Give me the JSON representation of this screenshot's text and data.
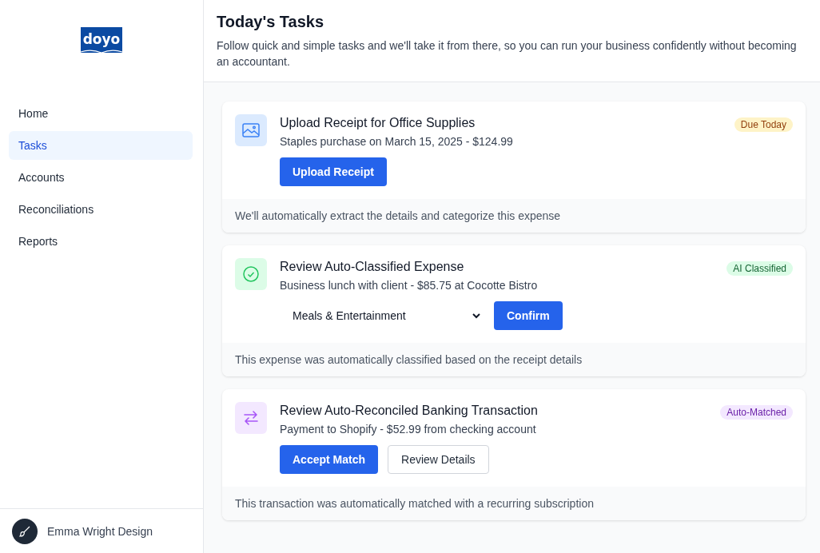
{
  "logo": {
    "text": "doyo"
  },
  "sidebar": {
    "items": [
      {
        "label": "Home",
        "selected": false
      },
      {
        "label": "Tasks",
        "selected": true
      },
      {
        "label": "Accounts",
        "selected": false
      },
      {
        "label": "Reconciliations",
        "selected": false
      },
      {
        "label": "Reports",
        "selected": false
      }
    ],
    "user": {
      "name": "Emma Wright Design"
    }
  },
  "header": {
    "title": "Today's Tasks",
    "subtitle": "Follow quick and simple tasks and we'll take it from there, so you can run your business confidently without becoming an accountant."
  },
  "tasks": [
    {
      "kind": "upload",
      "title": "Upload Receipt for Office Supplies",
      "detail": "Staples purchase on March 15, 2025 - $124.99",
      "badge": "Due Today",
      "color": "#fef3c7",
      "actions": [
        {
          "kind": "primary",
          "label": "Upload Receipt"
        }
      ],
      "footer": "We'll automatically extract the details and categorize this expense"
    },
    {
      "kind": "classify",
      "title": "Review Auto-Classified Expense",
      "detail": "Business lunch with client - $85.75 at Cocotte Bistro",
      "badge": "AI Classified",
      "color": "#dcfce7",
      "actions": [
        {
          "kind": "select",
          "value": "Meals & Entertainment"
        },
        {
          "kind": "primary",
          "label": "Confirm"
        }
      ],
      "footer": "This expense was automatically classified based on the receipt details"
    },
    {
      "kind": "match",
      "title": "Review Auto-Reconciled Banking Transaction",
      "detail": "Payment to Shopify - $52.99 from checking account",
      "badge": "Auto-Matched",
      "color": "#f3e8ff",
      "actions": [
        {
          "kind": "primary",
          "label": "Accept Match"
        },
        {
          "kind": "secondary",
          "label": "Review Details"
        }
      ],
      "footer": "This transaction was automatically matched with a recurring subscription"
    }
  ]
}
